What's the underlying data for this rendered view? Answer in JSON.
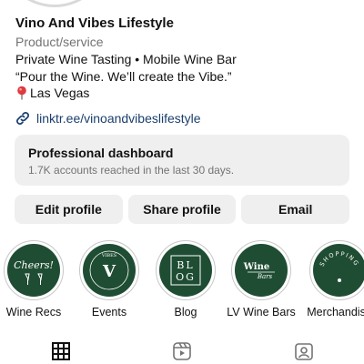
{
  "profile": {
    "name": "Vino And Vibes Lifestyle",
    "category": "Product/service",
    "bio_line1": "Private Wine Tasting • Mobile Wine Bar",
    "bio_line2": "“Pour the Wine. We’ll create the Vibe.”",
    "location": "Las Vegas",
    "link": "linktr.ee/vinoandvibeslifestyle"
  },
  "dashboard": {
    "title": "Professional dashboard",
    "subtitle": "1.7K accounts reached in the last 30 days."
  },
  "buttons": {
    "edit": "Edit profile",
    "share": "Share profile",
    "email": "Email"
  },
  "highlights": [
    {
      "label": "Wine Recs",
      "cover_text": "Cheers!"
    },
    {
      "label": "Events",
      "cover_text": "V",
      "cover_ring_text": "VIBES"
    },
    {
      "label": "Blog",
      "cover_text": "BLOG"
    },
    {
      "label": "LV Wine Bars",
      "cover_text": "Wine Bars"
    },
    {
      "label": "Merchandise",
      "cover_text": "SHOPPING"
    }
  ],
  "colors": {
    "highlight_cover": "#1f4d33",
    "link": "#1a3f6e",
    "button_bg": "#efefef",
    "secondary_text": "#737373",
    "pin": "#e0393e"
  },
  "tabs": [
    {
      "icon": "grid-icon"
    },
    {
      "icon": "reels-icon"
    },
    {
      "icon": "tagged-icon"
    }
  ]
}
